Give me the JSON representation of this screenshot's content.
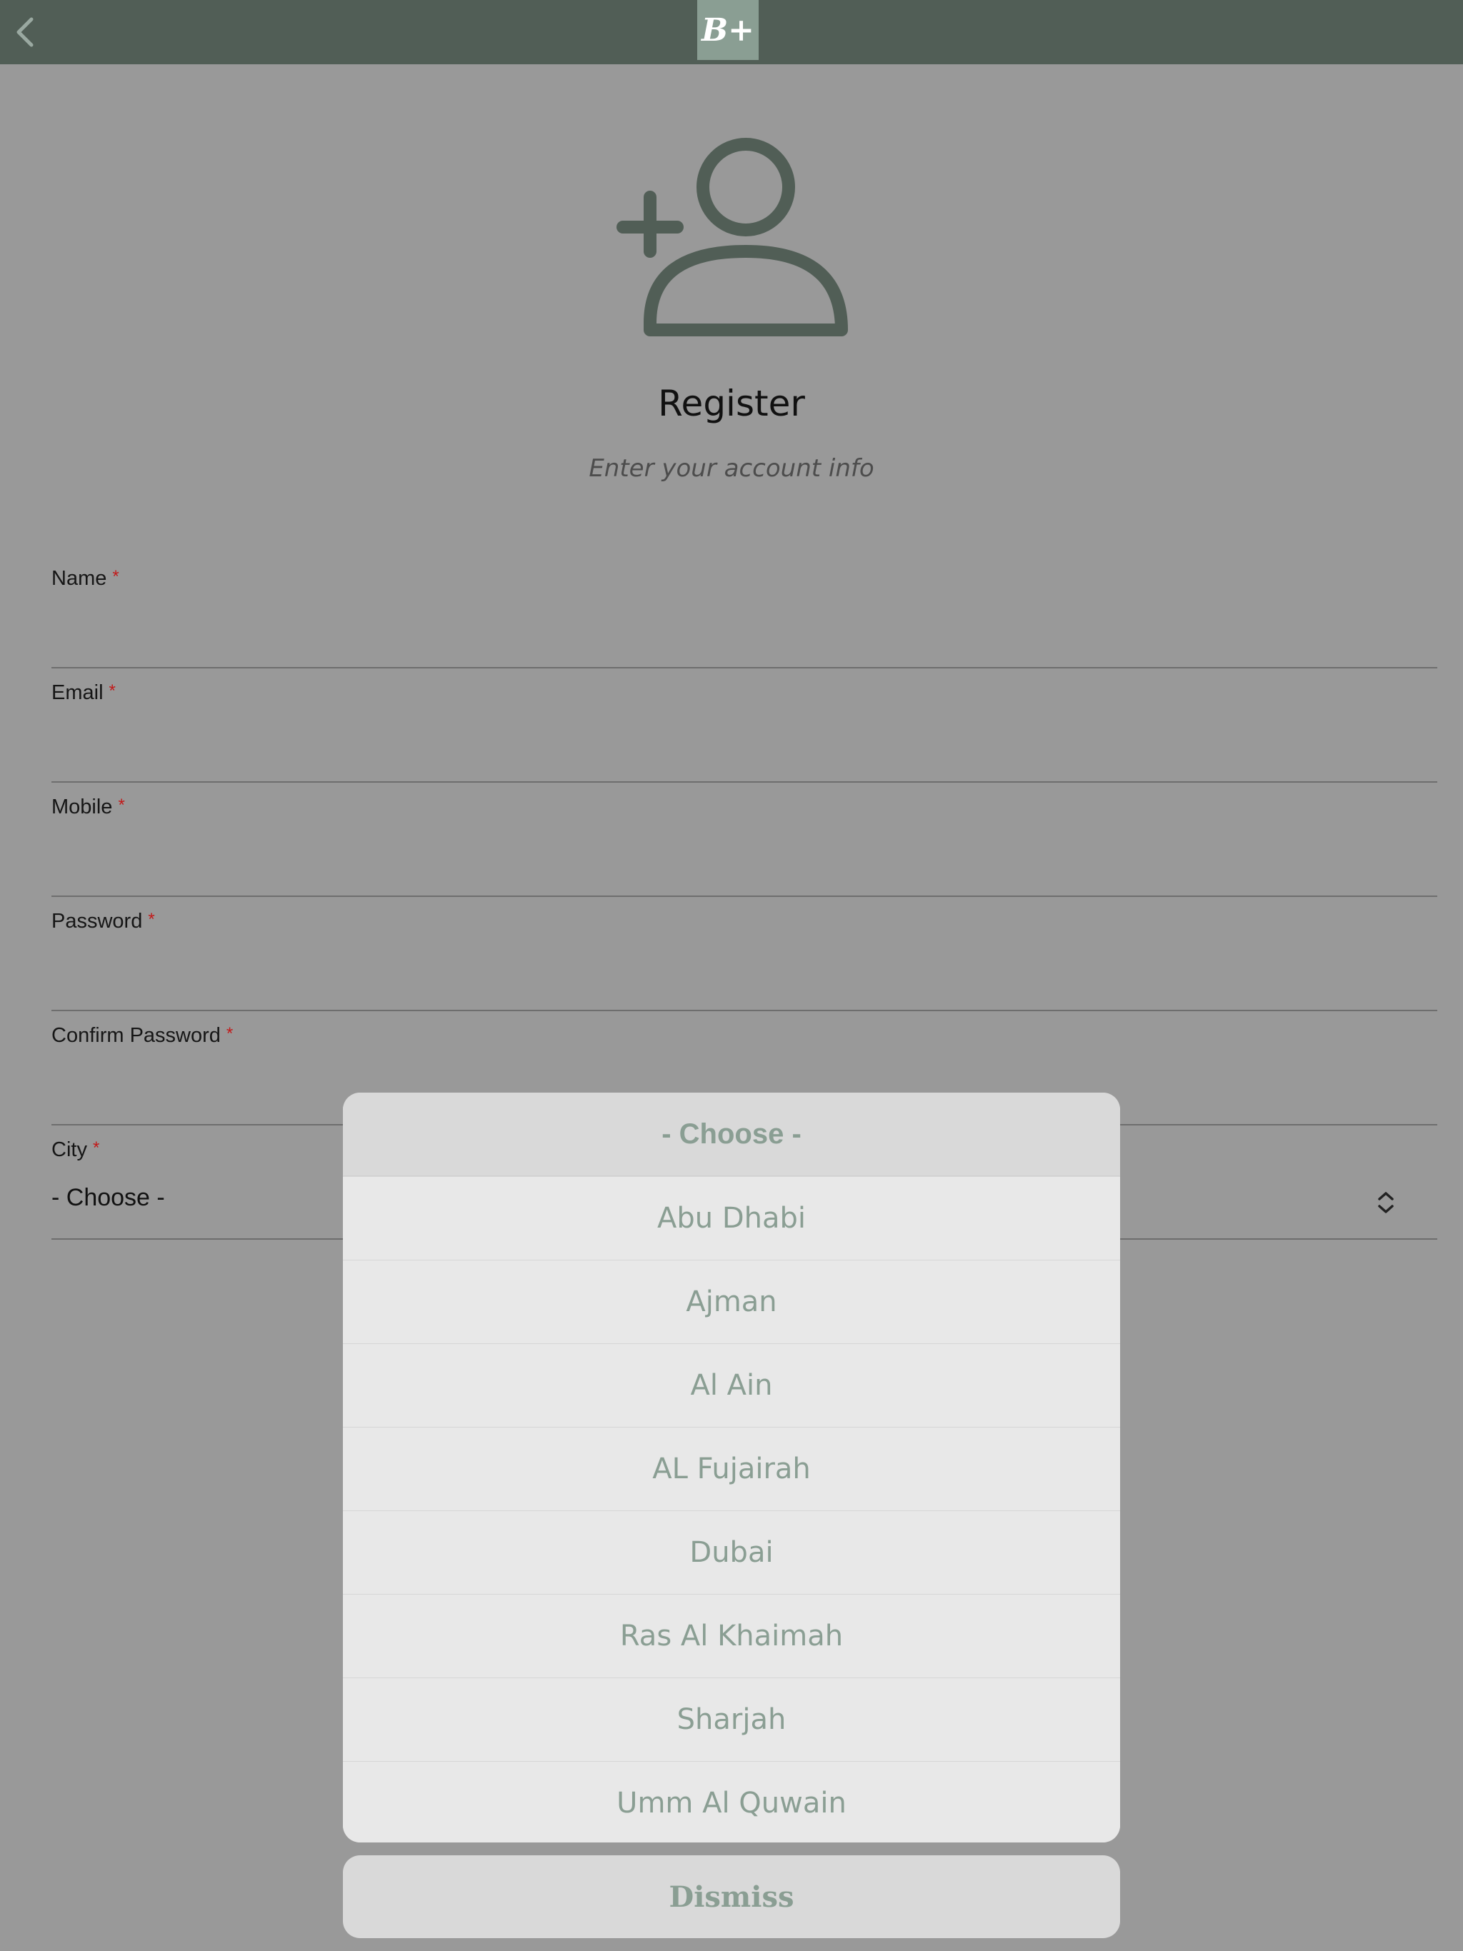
{
  "logo": {
    "text": "B+"
  },
  "header": {
    "title": "Register",
    "subtitle": "Enter your account info"
  },
  "form": {
    "required_marker": "*",
    "fields": [
      {
        "label": "Name",
        "value": ""
      },
      {
        "label": "Email",
        "value": ""
      },
      {
        "label": "Mobile",
        "value": ""
      },
      {
        "label": "Password",
        "value": ""
      },
      {
        "label": "Confirm Password",
        "value": ""
      }
    ],
    "city": {
      "label": "City",
      "value": "- Choose -"
    }
  },
  "picker": {
    "header": "- Choose -",
    "options": [
      "Abu Dhabi",
      "Ajman",
      "Al Ain",
      "AL Fujairah",
      "Dubai",
      "Ras Al Khaimah",
      "Sharjah",
      "Umm Al Quwain"
    ],
    "dismiss_label": "Dismiss"
  },
  "colors": {
    "topbar": "#515e56",
    "accent": "#8a9e93",
    "required": "#c21a1a",
    "backdrop": "#999999"
  },
  "icons": {
    "back": "chevron-left-icon",
    "avatar": "user-plus-icon",
    "select": "chevron-up-down-icon"
  }
}
